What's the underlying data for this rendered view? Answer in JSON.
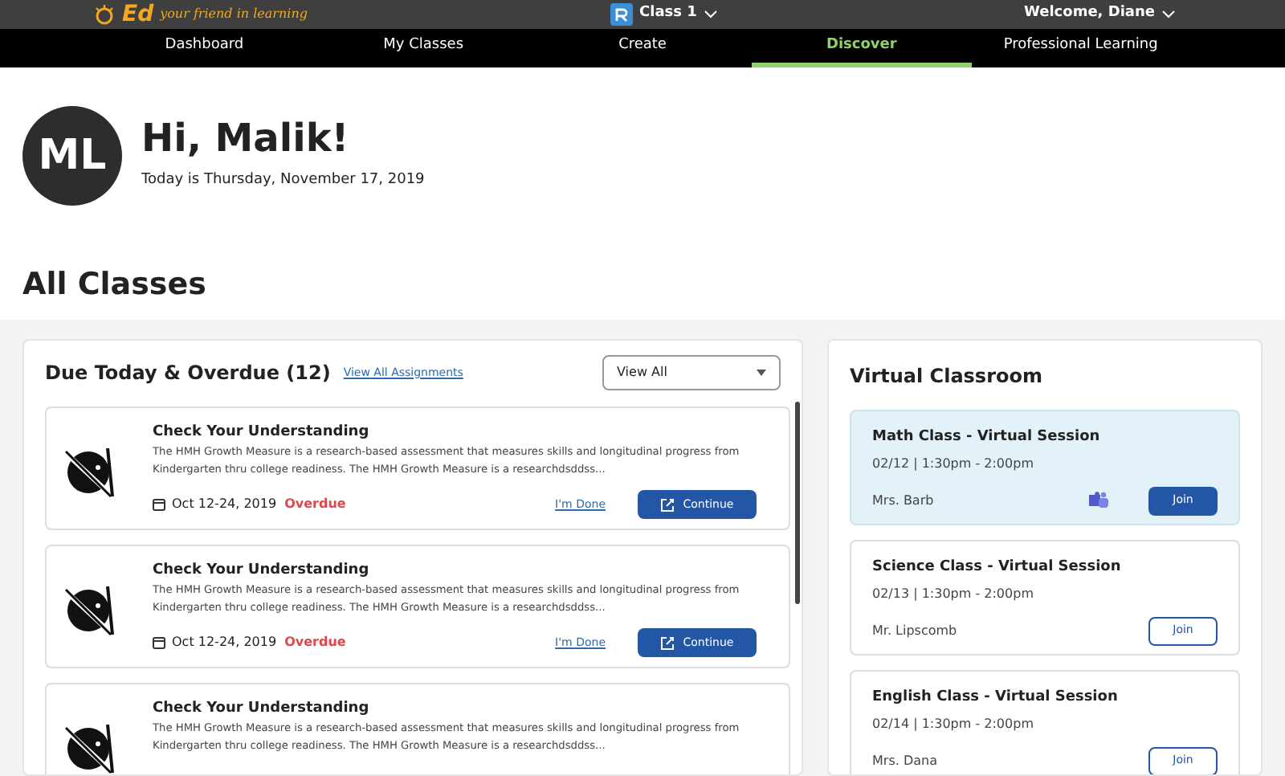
{
  "header": {
    "logo": "Ed",
    "tagline": "your friend in learning",
    "class_selector": "Class 1",
    "welcome": "Welcome, Diane"
  },
  "nav": [
    {
      "label": "Dashboard",
      "selected": false
    },
    {
      "label": "My Classes",
      "selected": false
    },
    {
      "label": "Create",
      "selected": false
    },
    {
      "label": "Discover",
      "selected": true
    },
    {
      "label": "Professional Learning",
      "selected": false
    }
  ],
  "profile": {
    "initials": "ML",
    "greeting": "Hi, Malik!",
    "date": "Today is Thursday, November 17, 2019"
  },
  "section_title": "All Classes",
  "assignments_panel": {
    "title": "Due Today & Overdue (12)",
    "link": "View All Assignments",
    "filter": "View All",
    "items": [
      {
        "title": "Check Your Understanding",
        "description": "The HMH Growth Measure is a research-based assessment that measures skills and longitudinal progress from Kindergarten thru college readiness. The HMH Growth Measure is a researchdsddss...",
        "dates": "Oct 12-24, 2019",
        "status": "Overdue",
        "kind": "overdue",
        "done": "I'm Done",
        "action": "Continue"
      },
      {
        "title": "Check Your Understanding",
        "description": "The HMH Growth Measure is a research-based assessment that measures skills and longitudinal progress from Kindergarten thru college readiness. The HMH Growth Measure is a researchdsddss...",
        "dates": "Oct 12-24, 2019",
        "status": "Overdue",
        "kind": "overdue",
        "done": "I'm Done",
        "action": "Continue"
      },
      {
        "title": "Check Your Understanding",
        "description": "The HMH Growth Measure is a research-based assessment that measures skills and longitudinal progress from Kindergarten thru college readiness. The HMH Growth Measure is a researchdsddss..."
      }
    ]
  },
  "virtual_classroom": {
    "title": "Virtual Classroom",
    "sessions": [
      {
        "title": "Math Class - Virtual Session",
        "time": "02/12 | 1:30pm - 2:00pm",
        "teacher": "Mrs. Barb",
        "action": "Join",
        "selected": true
      },
      {
        "title": "Science Class - Virtual Session",
        "time": "02/13 | 1:30pm - 2:00pm",
        "teacher": "Mr. Lipscomb",
        "action": "Join",
        "selected": false
      },
      {
        "title": "English Class - Virtual Session",
        "time": "02/14 | 1:30pm - 2:00pm",
        "teacher": "Mrs. Dana",
        "action": "Join",
        "selected": false
      }
    ]
  }
}
